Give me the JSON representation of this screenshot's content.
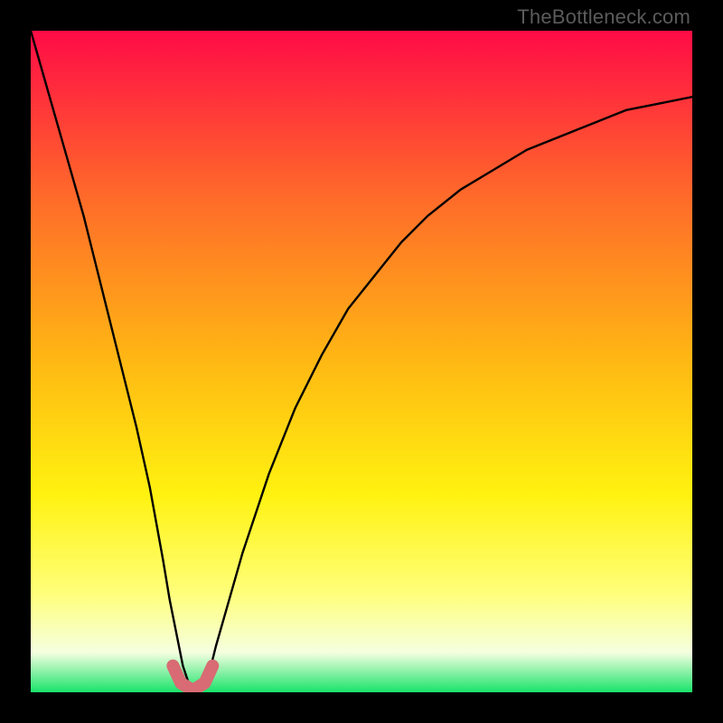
{
  "watermark": "TheBottleneck.com",
  "chart_data": {
    "type": "line",
    "title": "",
    "xlabel": "",
    "ylabel": "",
    "xlim": [
      0,
      100
    ],
    "ylim": [
      0,
      100
    ],
    "grid": false,
    "description": "Bottleneck percentage curve over a red-to-green vertical gradient background. The curve dips to ~0% (green) near x≈24 and rises toward high bottleneck (red) on both sides.",
    "series": [
      {
        "name": "bottleneck-curve",
        "x": [
          0,
          2,
          4,
          6,
          8,
          10,
          12,
          14,
          16,
          18,
          20,
          21,
          22,
          23,
          24,
          25,
          26,
          27,
          28,
          30,
          32,
          34,
          36,
          38,
          40,
          44,
          48,
          52,
          56,
          60,
          65,
          70,
          75,
          80,
          85,
          90,
          95,
          100
        ],
        "y": [
          100,
          93,
          86,
          79,
          72,
          64,
          56,
          48,
          40,
          31,
          20,
          14,
          9,
          4,
          1,
          0,
          1,
          3,
          7,
          14,
          21,
          27,
          33,
          38,
          43,
          51,
          58,
          63,
          68,
          72,
          76,
          79,
          82,
          84,
          86,
          88,
          89,
          90
        ]
      }
    ],
    "optimum_marker": {
      "x_range": [
        21.5,
        27.5
      ],
      "y_range": [
        0,
        4
      ],
      "color": "#d86b74"
    },
    "background_gradient": {
      "stops": [
        {
          "y": 100,
          "color": "#ff0b46"
        },
        {
          "y": 75,
          "color": "#ff6a2a"
        },
        {
          "y": 50,
          "color": "#ffb813"
        },
        {
          "y": 30,
          "color": "#fff210"
        },
        {
          "y": 15,
          "color": "#ffff7a"
        },
        {
          "y": 6,
          "color": "#f5ffe0"
        },
        {
          "y": 0,
          "color": "#19e36a"
        }
      ]
    }
  }
}
